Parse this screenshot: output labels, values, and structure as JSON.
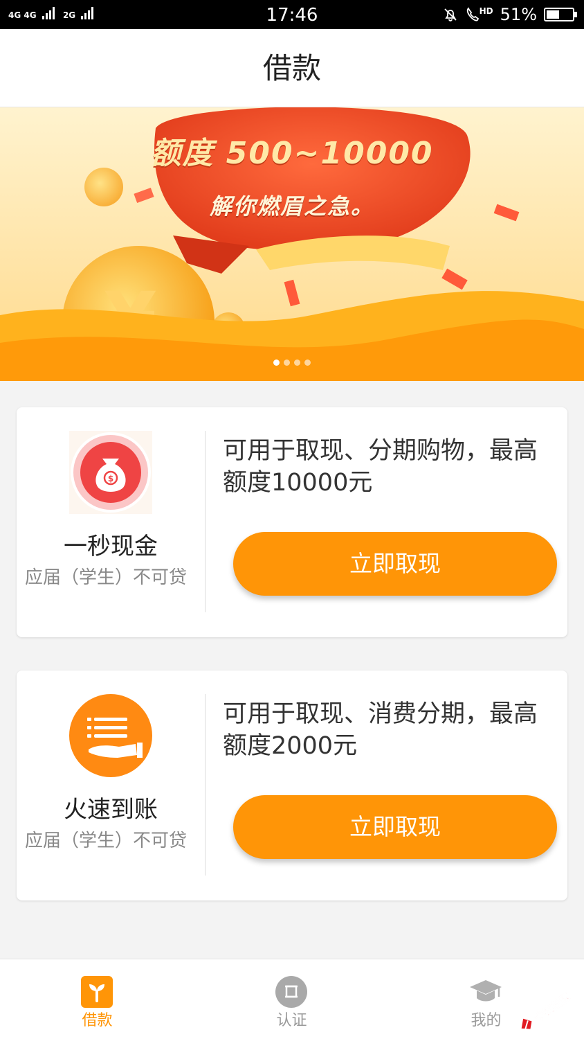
{
  "status_bar": {
    "network_left": "4G 4G",
    "network_right": "2G",
    "time": "17:46",
    "hd": "HD",
    "battery_text": "51%",
    "battery_level": 0.51
  },
  "header": {
    "title": "借款"
  },
  "banner": {
    "title": "额度 500~10000",
    "subtitle": "解你燃眉之急。",
    "slide_count": 4,
    "active_slide": 1
  },
  "products": [
    {
      "name": "一秒现金",
      "note": "应届（学生）不可贷",
      "description": "可用于取现、分期购物，最高额度10000元",
      "button_label": "立即取现",
      "icon": "money-bag-icon"
    },
    {
      "name": "火速到账",
      "note": "应届（学生）不可贷",
      "description": "可用于取现、消费分期，最高额度2000元",
      "button_label": "立即取现",
      "icon": "hand-list-icon"
    }
  ],
  "tabbar": {
    "items": [
      {
        "label": "借款",
        "icon": "sprout-icon",
        "active": true
      },
      {
        "label": "认证",
        "icon": "certificate-icon",
        "active": false
      },
      {
        "label": "我的",
        "icon": "graduation-cap-icon",
        "active": false
      }
    ]
  },
  "colors": {
    "accent": "#ff9507",
    "inactive": "#9a9a9a"
  }
}
